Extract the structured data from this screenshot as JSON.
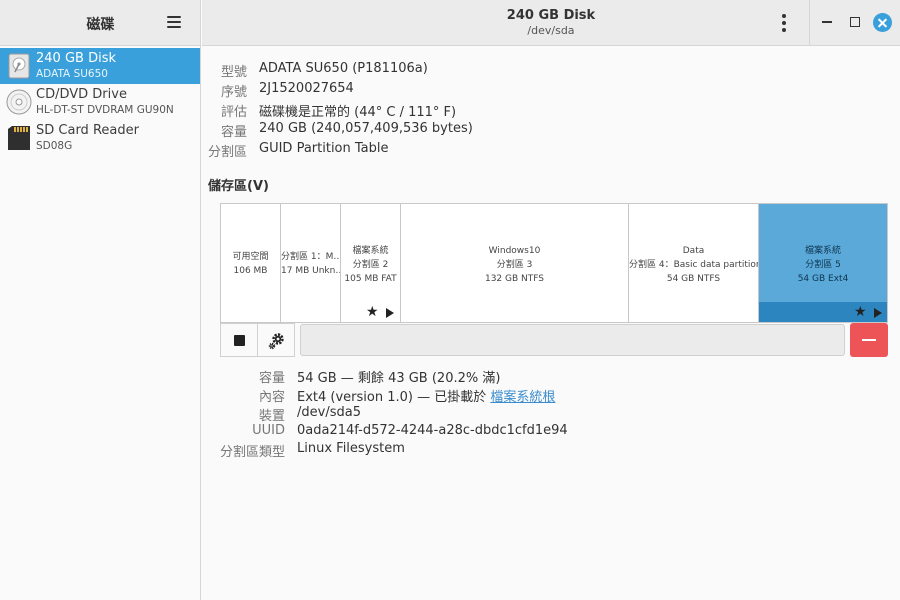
{
  "sidebar": {
    "title": "磁碟",
    "items": [
      {
        "name": "240 GB Disk",
        "sub": "ADATA SU650",
        "selected": true,
        "icon": "ssd-disk-icon"
      },
      {
        "name": "CD/DVD Drive",
        "sub": "HL-DT-ST DVDRAM GU90N",
        "selected": false,
        "icon": "optical-disc-icon"
      },
      {
        "name": "SD Card Reader",
        "sub": "SD08G",
        "selected": false,
        "icon": "sd-card-icon"
      }
    ]
  },
  "header": {
    "title": "240 GB Disk",
    "subtitle": "/dev/sda"
  },
  "disk_info": [
    {
      "label": "型號",
      "value": "ADATA SU650 (P181106a)"
    },
    {
      "label": "序號",
      "value": "2J1520027654"
    },
    {
      "label": "評估",
      "value": "磁碟機是正常的 (44° C / 111° F)"
    },
    {
      "label": "容量",
      "value": "240 GB (240,057,409,536 bytes)"
    },
    {
      "label": "分割區",
      "value": "GUID Partition Table"
    }
  ],
  "volumes": {
    "title": "儲存區(V)",
    "segments": [
      {
        "lines": [
          "可用空間",
          "106 MB"
        ]
      },
      {
        "lines": [
          "分割區 1：M…",
          "17 MB Unkn…"
        ]
      },
      {
        "lines": [
          "檔案系統",
          "分割區 2",
          "105 MB FAT"
        ]
      },
      {
        "lines": [
          "Windows10",
          "分割區 3",
          "132 GB NTFS"
        ]
      },
      {
        "lines": [
          "Data",
          "分割區 4：Basic data partition",
          "54 GB NTFS"
        ]
      },
      {
        "lines": [
          "檔案系統",
          "分割區 5",
          "54 GB Ext4"
        ],
        "selected": true
      }
    ]
  },
  "volume_details": {
    "size_label": "容量",
    "size_value": "54 GB — 剩餘 43 GB (20.2% 滿)",
    "contents_label": "內容",
    "contents_value": "Ext4 (version 1.0) — 已掛載於 ",
    "contents_link": "檔案系統根",
    "device_label": "裝置",
    "device_value": "/dev/sda5",
    "uuid_label": "UUID",
    "uuid_value": "0ada214f-d572-4244-a28c-dbdc1cfd1e94",
    "ptype_label": "分割區類型",
    "ptype_value": "Linux Filesystem"
  },
  "colors": {
    "accent": "#3aa0dc",
    "selected_segment": "#5aa9d9",
    "delete_button": "#ec5458"
  }
}
